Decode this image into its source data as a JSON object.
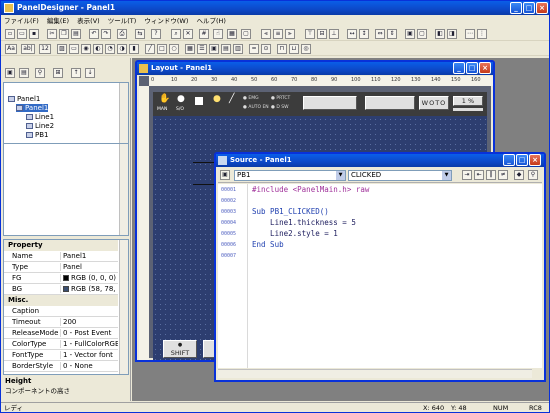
{
  "app": {
    "title": "PanelDesigner - Panel1"
  },
  "menu": [
    "ファイル(F)",
    "編集(E)",
    "表示(V)",
    "ツール(T)",
    "ウィンドウ(W)",
    "ヘルプ(H)"
  ],
  "toolbar1": [
    "new",
    "open",
    "save",
    "cut",
    "copy",
    "paste",
    "undo",
    "redo",
    "print",
    "sync",
    "help",
    "zoom",
    "tools",
    "grid",
    "align",
    "layout",
    "order",
    "group",
    "size",
    "space",
    "dist"
  ],
  "toolbar2": [
    "Aa",
    "ab|",
    "12"
  ],
  "tree": {
    "items": [
      "Panel1",
      "Panel1",
      "Line1",
      "Line2",
      "PB1"
    ]
  },
  "props": {
    "header": "Property",
    "rows1": [
      [
        "Name",
        "Panel1"
      ],
      [
        "Type",
        "Panel"
      ],
      [
        "FG",
        "RGB (0, 0, 0)"
      ],
      [
        "BG",
        "RGB (58, 78, 11"
      ]
    ],
    "misc": "Misc.",
    "rows2": [
      [
        "Caption",
        ""
      ],
      [
        "Timeout",
        "200"
      ],
      [
        "ReleaseMode",
        "0 - Post Event"
      ],
      [
        "ColorType",
        "1 - FullColorRGB"
      ],
      [
        "FontType",
        "1 - Vector font"
      ],
      [
        "BorderStyle",
        "0 - None"
      ]
    ],
    "desc_title": "Height",
    "desc_text": "コンポーネントの高さ",
    "colors": {
      "fg": "#000000",
      "bg": "#3a4e70"
    }
  },
  "layout_win": {
    "title": "Layout - Panel1",
    "panel": {
      "btn_man": "MAN",
      "btn_so": "S/O",
      "emg": "EMG",
      "autoen": "AUTO EN",
      "prtct": "PRTCT",
      "dsw": "D SW",
      "woto": "WOTO",
      "pct": "1 %",
      "shift": "SHIFT"
    },
    "ruler_marks": [
      "0",
      "10",
      "20",
      "30",
      "40",
      "50",
      "60",
      "70",
      "80",
      "90",
      "100",
      "110",
      "120",
      "130",
      "140",
      "150",
      "160"
    ]
  },
  "source_win": {
    "title": "Source - Panel1",
    "object_combo": "PB1",
    "event_combo": "CLICKED",
    "line_numbers": [
      "00001",
      "00002",
      "00003",
      "00004",
      "00005",
      "00006",
      "00007"
    ],
    "lines": [
      "#include <PanelMain.h> raw",
      "",
      "Sub PB1_CLICKED()",
      "    Line1.thickness = 5",
      "    Line2.style = 1",
      "End Sub",
      ""
    ]
  },
  "status": {
    "left": "レディ",
    "x": "X:  640",
    "y": "Y:  48",
    "num": "NUM",
    "rc": "RC8"
  }
}
